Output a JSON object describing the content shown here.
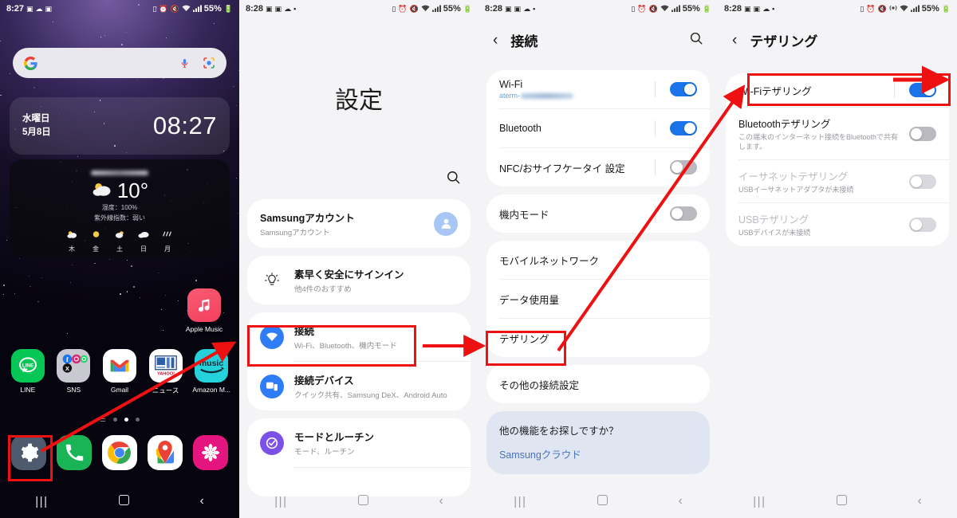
{
  "panels": [
    {
      "id": "home-screen",
      "statusbar": {
        "time": "8:27",
        "left_icons": [
          "picture-icon",
          "cloud-icon",
          "picture-icon"
        ],
        "right_icons": [
          "battery-saver-icon",
          "alarm-icon",
          "mute-icon",
          "wifi-icon",
          "signal-icon"
        ],
        "battery": "55%"
      },
      "search": {
        "placeholder": "",
        "logo": "google-logo",
        "mic": "mic-icon",
        "lens": "google-lens-icon"
      },
      "clock_widget": {
        "weekday": "水曜日",
        "date": "5月8日",
        "time": "08:27"
      },
      "weather_widget": {
        "city": "",
        "temp": "10°",
        "condition_icon": "partly-cloudy-icon",
        "humidity": "湿度：100%",
        "uv": "紫外線指数：弱い",
        "forecast": [
          {
            "day": "木",
            "icon": "partly-cloudy-icon"
          },
          {
            "day": "金",
            "icon": "sunny-icon"
          },
          {
            "day": "土",
            "icon": "partly-cloudy-icon"
          },
          {
            "day": "日",
            "icon": "cloudy-icon"
          },
          {
            "day": "月",
            "icon": "rain-icon"
          }
        ]
      },
      "apps_row_top": [
        {
          "label": "Apple Music",
          "icon": "apple-music-icon"
        }
      ],
      "apps_row": [
        {
          "label": "LINE",
          "icon": "line-icon"
        },
        {
          "label": "SNS",
          "icon": "sns-folder-icon"
        },
        {
          "label": "Gmail",
          "icon": "gmail-icon"
        },
        {
          "label": "ニュース",
          "icon": "yahoo-news-icon"
        },
        {
          "label": "Amazon M...",
          "icon": "amazon-music-icon"
        }
      ],
      "page_dots": {
        "count": 4,
        "active": 2
      },
      "dock": [
        {
          "label": "設定",
          "icon": "settings-gear-icon"
        },
        {
          "label": "電話",
          "icon": "phone-icon"
        },
        {
          "label": "Chrome",
          "icon": "chrome-icon"
        },
        {
          "label": "マップ",
          "icon": "google-maps-icon"
        },
        {
          "label": "ギャラリー",
          "icon": "photos-flower-icon"
        }
      ],
      "navbar": [
        "recents-icon",
        "home-icon",
        "back-icon"
      ]
    },
    {
      "id": "settings-screen",
      "statusbar": {
        "time": "8:28",
        "left_icons": [
          "picture-icon",
          "picture-icon",
          "cloud-icon",
          "dot-icon"
        ],
        "right_icons": [
          "battery-saver-icon",
          "alarm-icon",
          "mute-icon",
          "wifi-icon",
          "signal-icon"
        ],
        "battery": "55%"
      },
      "title": "設定",
      "search_icon": "search-icon",
      "items": [
        {
          "title": "Samsungアカウント",
          "subtitle": "Samsungアカウント",
          "icon": "account-avatar-icon",
          "card": 1
        },
        {
          "title": "素早く安全にサインイン",
          "subtitle": "他4件のおすすめ",
          "icon": "lightbulb-icon",
          "card": 2
        },
        {
          "title": "接続",
          "subtitle": "Wi-Fi、Bluetooth、機内モード",
          "icon": "wifi-circle-icon",
          "card": 3,
          "highlighted": true
        },
        {
          "title": "接続デバイス",
          "subtitle": "クイック共有、Samsung DeX、Android Auto",
          "icon": "devices-icon",
          "card": 3
        },
        {
          "title": "モードとルーチン",
          "subtitle": "モード、ルーチン",
          "icon": "modes-routines-icon",
          "card": 4
        }
      ],
      "navbar": [
        "recents-icon",
        "home-icon",
        "back-icon"
      ]
    },
    {
      "id": "connections-screen",
      "statusbar": {
        "time": "8:28",
        "left_icons": [
          "picture-icon",
          "picture-icon",
          "cloud-icon",
          "dot-icon"
        ],
        "right_icons": [
          "battery-saver-icon",
          "alarm-icon",
          "mute-icon",
          "wifi-icon",
          "signal-icon"
        ],
        "battery": "55%"
      },
      "header": {
        "back": "back-chevron-icon",
        "title": "接続",
        "search": "search-icon"
      },
      "group1": [
        {
          "title": "Wi-Fi",
          "subtitle": "aterm-",
          "subtitle_masked": true,
          "toggle": "on"
        },
        {
          "title": "Bluetooth",
          "subtitle": "",
          "toggle": "on"
        },
        {
          "title": "NFC/おサイフケータイ 設定",
          "subtitle": "",
          "toggle": "off"
        }
      ],
      "group2": [
        {
          "title": "機内モード",
          "subtitle": "",
          "toggle": "off"
        }
      ],
      "group3": [
        {
          "title": "モバイルネットワーク"
        },
        {
          "title": "データ使用量"
        },
        {
          "title": "テザリング",
          "highlighted": true
        }
      ],
      "group4": [
        {
          "title": "その他の接続設定"
        }
      ],
      "info": {
        "title": "他の機能をお探しですか？",
        "link": "Samsungクラウド"
      },
      "navbar": [
        "recents-icon",
        "home-icon",
        "back-icon"
      ]
    },
    {
      "id": "tethering-screen",
      "statusbar": {
        "time": "8:28",
        "left_icons": [
          "picture-icon",
          "picture-icon",
          "cloud-icon",
          "dot-icon"
        ],
        "right_icons": [
          "battery-saver-icon",
          "alarm-icon",
          "mute-icon",
          "hotspot-icon",
          "wifi-icon",
          "signal-icon"
        ],
        "battery": "55%"
      },
      "header": {
        "back": "back-chevron-icon",
        "title": "テザリング"
      },
      "items": [
        {
          "title": "Wi-Fiテザリング",
          "subtitle": "",
          "toggle": "on",
          "highlighted": true
        },
        {
          "title": "Bluetoothテザリング",
          "subtitle": "この端末のインターネット接続をBluetoothで共有します。",
          "toggle": "off"
        },
        {
          "title": "イーサネットテザリング",
          "subtitle": "USBイーサネットアダプタが未接続",
          "toggle": "disabled",
          "disabled": true
        },
        {
          "title": "USBテザリング",
          "subtitle": "USBデバイスが未接続",
          "toggle": "disabled",
          "disabled": true
        }
      ],
      "navbar": [
        "recents-icon",
        "home-icon",
        "back-icon"
      ]
    }
  ],
  "annotations": {
    "highlight_color": "#ee1111",
    "arrows": [
      {
        "name": "arrow-settings-to-connections",
        "from": "dock-settings",
        "to": "settings-connections-row"
      },
      {
        "name": "arrow-connections-to-tethering",
        "from": "settings-connections-row",
        "to": "connections-tethering-row"
      },
      {
        "name": "arrow-tethering-to-wifi-tethering",
        "from": "connections-tethering-row",
        "to": "tethering-wifi-toggle"
      },
      {
        "name": "arrow-wifi-tethering-toggle",
        "from": "tethering-row-left",
        "to": "tethering-wifi-toggle-knob"
      }
    ]
  }
}
